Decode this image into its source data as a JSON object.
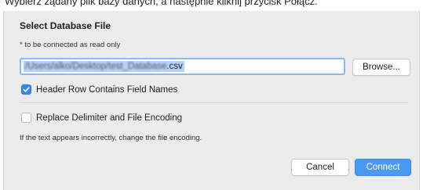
{
  "caption": "Wybierz żądany plik bazy danych, a następnie kliknij przycisk Połącz.",
  "dialog": {
    "title": "Select Database File",
    "subtitle": "* to be connected as read only",
    "path_prefix": "/Users/alko/Desktop/test_Database",
    "path_extension": ".csv",
    "browse_label": "Browse...",
    "header_row_label": "Header Row Contains Field Names",
    "header_row_checked": true,
    "replace_label": "Replace Delimiter and File Encoding",
    "replace_checked": false,
    "hint": "If the text appears incorrectly, change the file encoding.",
    "cancel_label": "Cancel",
    "connect_label": "Connect"
  },
  "colors": {
    "accent": "#4a9af4",
    "checkbox": "#3a86f2",
    "selection": "#b4d3f6",
    "dialog_bg": "#ececec"
  },
  "icons": {
    "checkbox_checked": "checkmark-icon"
  }
}
